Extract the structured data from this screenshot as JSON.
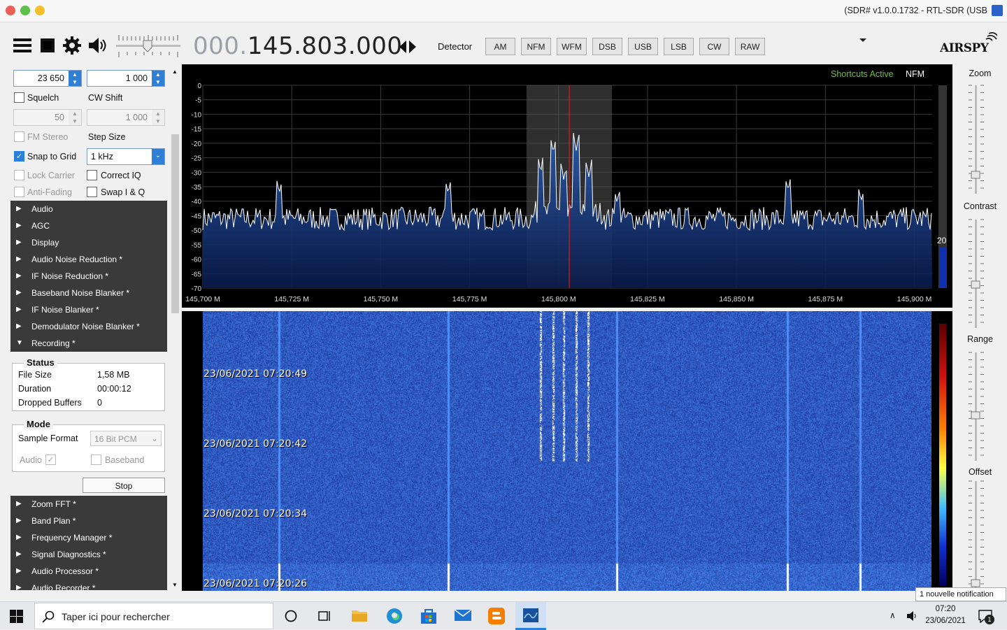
{
  "window": {
    "title": "(SDR# v1.0.0.1732 - RTL-SDR (USB"
  },
  "toolbar": {
    "frequency_dim": "000.",
    "frequency_main": "145.803.000",
    "detector_label": "Detector",
    "modes": [
      "AM",
      "NFM",
      "WFM",
      "DSB",
      "USB",
      "LSB",
      "CW",
      "RAW"
    ],
    "logo": "AIRSPY",
    "volume_level": 0.6
  },
  "sidebar": {
    "bandwidth_value": "23 650",
    "order_value": "1 000",
    "squelch_label": "Squelch",
    "cw_shift_label": "CW Shift",
    "squelch_value": "50",
    "cw_shift_value": "1 000",
    "fm_stereo_label": "FM Stereo",
    "step_size_label": "Step Size",
    "snap_label": "Snap to Grid",
    "step_value": "1 kHz",
    "lock_carrier_label": "Lock Carrier",
    "correct_iq_label": "Correct IQ",
    "anti_fading_label": "Anti-Fading",
    "swap_iq_label": "Swap I & Q",
    "panels_top": [
      "Audio",
      "AGC",
      "Display",
      "Audio Noise Reduction *",
      "IF Noise Reduction *",
      "Baseband Noise Blanker *",
      "IF Noise Blanker *",
      "Demodulator Noise Blanker *"
    ],
    "recording_panel": "Recording *",
    "status": {
      "title": "Status",
      "rows": [
        {
          "label": "File Size",
          "value": "1,58 MB"
        },
        {
          "label": "Duration",
          "value": "00:00:12"
        },
        {
          "label": "Dropped Buffers",
          "value": "0"
        }
      ]
    },
    "mode": {
      "title": "Mode",
      "sample_format_label": "Sample Format",
      "sample_format_value": "16 Bit PCM",
      "audio_label": "Audio",
      "baseband_label": "Baseband",
      "stop_label": "Stop"
    },
    "panels_bottom": [
      "Zoom FFT *",
      "Band Plan *",
      "Frequency Manager *",
      "Signal Diagnostics *",
      "Audio Processor *",
      "Audio Recorder *"
    ]
  },
  "spectrum": {
    "shortcuts_label": "Shortcuts Active",
    "mode_label": "NFM",
    "db_ticks": [
      "0",
      "-5",
      "-10",
      "-15",
      "-20",
      "-25",
      "-30",
      "-35",
      "-40",
      "-45",
      "-50",
      "-55",
      "-60",
      "-65",
      "-70"
    ],
    "freq_ticks": [
      "145,700 M",
      "145,725 M",
      "145,750 M",
      "145,775 M",
      "145,800 M",
      "145,825 M",
      "145,850 M",
      "145,875 M",
      "145,900 M"
    ],
    "level_label": "20",
    "start_mhz": 145.7,
    "end_mhz": 145.905,
    "tuned_mhz": 145.803,
    "filter_low_mhz": 145.791,
    "filter_high_mhz": 145.815,
    "noise_floor_db": -46,
    "peaks": [
      {
        "mhz": 145.7215,
        "db": -37
      },
      {
        "mhz": 145.769,
        "db": -37
      },
      {
        "mhz": 145.795,
        "db": -31
      },
      {
        "mhz": 145.7985,
        "db": -25
      },
      {
        "mhz": 145.8015,
        "db": -35
      },
      {
        "mhz": 145.805,
        "db": -24
      },
      {
        "mhz": 145.8085,
        "db": -33
      },
      {
        "mhz": 145.8165,
        "db": -40
      },
      {
        "mhz": 145.8645,
        "db": -37
      },
      {
        "mhz": 145.885,
        "db": -40
      }
    ]
  },
  "waterfall": {
    "timestamps": [
      "23/06/2021 07:20:49",
      "23/06/2021 07:20:42",
      "23/06/2021 07:20:34",
      "23/06/2021 07:20:26"
    ]
  },
  "right_panel": {
    "zoom_label": "Zoom",
    "contrast_label": "Contrast",
    "range_label": "Range",
    "offset_label": "Offset"
  },
  "notification": {
    "text": "1 nouvelle notification"
  },
  "taskbar": {
    "search_placeholder": "Taper ici pour rechercher",
    "time": "07:20",
    "date": "23/06/2021",
    "notif_count": "1"
  },
  "colors": {
    "accent": "#2a7fdc",
    "spectrum_fill": "#1f4fa0",
    "waterfall": "#1a3fb8",
    "tuned_line": "#e01a1a"
  }
}
